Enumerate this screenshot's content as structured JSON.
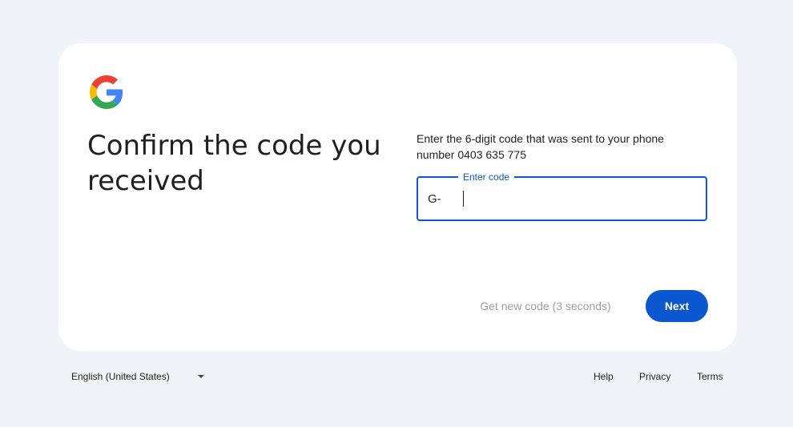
{
  "card": {
    "headline": "Confirm the code you received",
    "instructions": "Enter the 6-digit code that was sent to your phone number 0403 635 775",
    "code_field": {
      "label": "Enter code",
      "prefix": "G-",
      "value": ""
    },
    "get_new_code_label": "Get new code (3 seconds)",
    "next_label": "Next"
  },
  "footer": {
    "language": "English (United States)",
    "links": {
      "help": "Help",
      "privacy": "Privacy",
      "terms": "Terms"
    }
  },
  "icons": {
    "logo": "google-logo-icon",
    "dropdown": "chevron-down-icon"
  },
  "colors": {
    "background": "#f0f4f9",
    "card": "#ffffff",
    "accent": "#0b57d0",
    "disabled_text": "#9aa0a6",
    "google_red": "#EA4335",
    "google_yellow": "#FBBC05",
    "google_green": "#34A853",
    "google_blue": "#4285F4"
  }
}
